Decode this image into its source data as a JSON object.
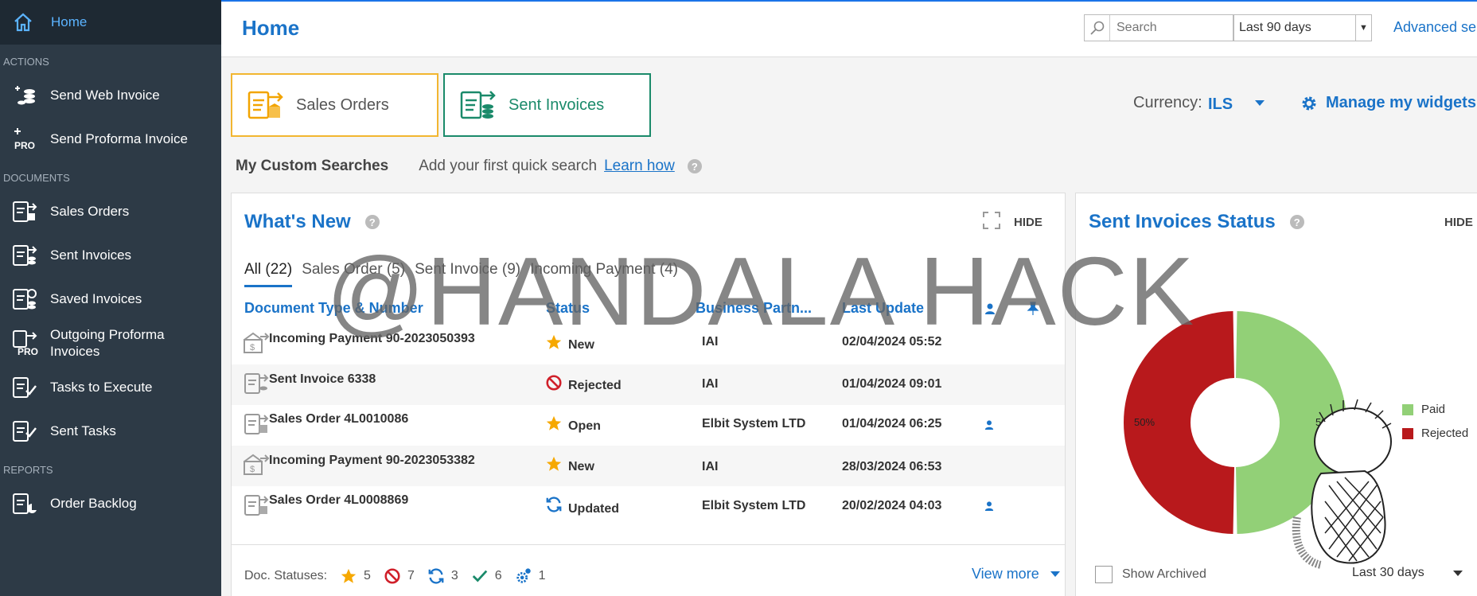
{
  "sidebar": {
    "home": "Home",
    "sections": {
      "actions": "ACTIONS",
      "documents": "DOCUMENTS",
      "reports": "REPORTS"
    },
    "actions": [
      {
        "label": "Send Web Invoice"
      },
      {
        "label": "Send Proforma Invoice",
        "badge": "PRO"
      }
    ],
    "documents": [
      {
        "label": "Sales Orders"
      },
      {
        "label": "Sent Invoices"
      },
      {
        "label": "Saved Invoices"
      },
      {
        "label": "Outgoing Proforma Invoices",
        "badge": "PRO"
      },
      {
        "label": "Tasks to Execute"
      },
      {
        "label": "Sent Tasks"
      }
    ],
    "reports": [
      {
        "label": "Order Backlog"
      }
    ]
  },
  "header": {
    "title": "Home",
    "search_placeholder": "Search",
    "range": "Last 90 days",
    "advanced": "Advanced se"
  },
  "tiles": {
    "sales_orders": "Sales Orders",
    "sent_invoices": "Sent Invoices"
  },
  "currency": {
    "label": "Currency:",
    "value": "ILS"
  },
  "manage_widgets": "Manage my widgets",
  "custom_searches": {
    "title": "My Custom Searches",
    "hint": "Add your first quick search",
    "link": "Learn how"
  },
  "whats_new": {
    "title": "What's New",
    "hide": "HIDE",
    "tabs": [
      "All (22)",
      "Sales Order (5)",
      "Sent Invoice (9)",
      "Incoming Payment (4)"
    ],
    "columns": [
      "Document Type & Number",
      "Status",
      "Business Partn...",
      "Last Update"
    ],
    "rows": [
      {
        "doc": "Incoming Payment 90-2023050393",
        "status": "New",
        "partner": "IAI",
        "updated": "02/04/2024 05:52"
      },
      {
        "doc": "Sent Invoice 6338",
        "status": "Rejected",
        "partner": "IAI",
        "updated": "01/04/2024 09:01"
      },
      {
        "doc": "Sales Order 4L0010086",
        "status": "Open",
        "partner": "Elbit System LTD",
        "updated": "01/04/2024 06:25"
      },
      {
        "doc": "Incoming Payment 90-2023053382",
        "status": "New",
        "partner": "IAI",
        "updated": "28/03/2024 06:53"
      },
      {
        "doc": "Sales Order 4L0008869",
        "status": "Updated",
        "partner": "Elbit System LTD",
        "updated": "20/02/2024 04:03"
      }
    ],
    "footer": {
      "label": "Doc. Statuses:",
      "counts": {
        "new": "5",
        "rejected": "7",
        "updated": "3",
        "approved": "6",
        "processing": "1"
      },
      "view_more": "View more"
    }
  },
  "sent_status": {
    "title": "Sent Invoices Status",
    "hide": "HIDE",
    "show_archived": "Show Archived",
    "range": "Last 30 days"
  },
  "chart_data": {
    "type": "pie",
    "labels": [
      "Paid",
      "Rejected"
    ],
    "values": [
      50,
      50
    ],
    "data_labels": [
      "50%",
      "50%"
    ],
    "colors": [
      "#92d077",
      "#b8191c"
    ],
    "legend_position": "right"
  },
  "watermark": "@HANDALA  HACK",
  "colors": {
    "sidebar": "#2d3a46",
    "accent": "#1a73c8",
    "sales_orders_border": "#f2b630",
    "sent_invoices_border": "#1a8a6a"
  }
}
